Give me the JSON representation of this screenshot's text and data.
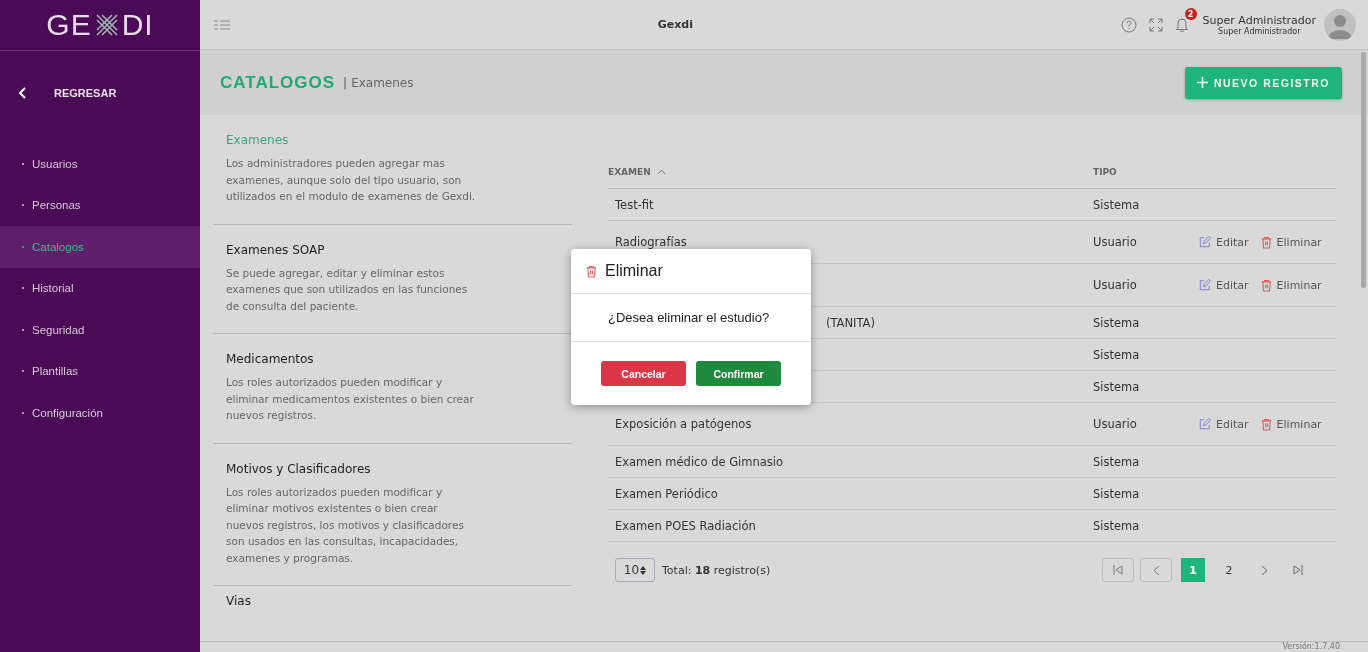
{
  "sidebar": {
    "logo_left": "GE",
    "logo_right": "DI",
    "back": "REGRESAR",
    "items": [
      {
        "label": "Usuarios",
        "selected": false
      },
      {
        "label": "Personas",
        "selected": false
      },
      {
        "label": "Catalogos",
        "selected": true
      },
      {
        "label": "Historial",
        "selected": false
      },
      {
        "label": "Seguridad",
        "selected": false
      },
      {
        "label": "Plantillas",
        "selected": false
      },
      {
        "label": "Configuración",
        "selected": false
      }
    ]
  },
  "topbar": {
    "title": "Gexdi",
    "notification_count": "2",
    "user_name": "Super Administrador",
    "user_role": "Super Administrador"
  },
  "header": {
    "title": "CATALOGOS",
    "separator": "|",
    "subtitle": "Examenes",
    "new_button": "NUEVO REGISTRO"
  },
  "catalogs": [
    {
      "title": "Examenes",
      "selected": true,
      "description": "Los administradores pueden agregar mas examenes, aunque solo del tipo usuario, son utilizados en el modulo de examenes de Gexdi."
    },
    {
      "title": "Examenes SOAP",
      "selected": false,
      "description": "Se puede agregar, editar y eliminar estos examenes que son utilizados en las funciones de consulta del paciente."
    },
    {
      "title": "Medicamentos",
      "selected": false,
      "description": "Los roles autorizados pueden modificar y eliminar medicamentos existentes o bien crear nuevos registros."
    },
    {
      "title": "Motivos y Clasificadores",
      "selected": false,
      "description": "Los roles autorizados pueden modificar y eliminar motivos existentes o bien crear nuevos registros, los motivos y clasificadores son usados en las consultas, incapacidades, examenes y programas."
    },
    {
      "title": "Vias",
      "selected": false
    }
  ],
  "table": {
    "columns": [
      {
        "label": "EXAMEN",
        "sorted": true
      },
      {
        "label": "TIPO"
      }
    ],
    "rows": [
      {
        "name": "Test-fit",
        "type": "Sistema",
        "covered": false,
        "actions": []
      },
      {
        "name": "Radiografías",
        "type": "Usuario",
        "covered": false,
        "actions": [
          {
            "kind": "edit",
            "label": "Editar"
          },
          {
            "kind": "delete",
            "label": "Eliminar"
          }
        ]
      },
      {
        "type": "Usuario",
        "actions": [
          {
            "kind": "edit",
            "label": "Editar"
          },
          {
            "kind": "delete",
            "label": "Eliminar"
          }
        ]
      },
      {
        "name": "(TANITA)",
        "type": "Sistema",
        "covered": true,
        "actions": []
      },
      {
        "type": "Sistema",
        "actions": []
      },
      {
        "type": "Sistema",
        "actions": []
      },
      {
        "name": "Exposición a patógenos",
        "type": "Usuario",
        "covered": false,
        "actions": [
          {
            "kind": "edit",
            "label": "Editar"
          },
          {
            "kind": "delete",
            "label": "Eliminar"
          }
        ]
      },
      {
        "name": "Examen médico de Gimnasio",
        "type": "Sistema",
        "covered": false,
        "actions": []
      },
      {
        "name": "Examen Periódico",
        "type": "Sistema",
        "covered": false,
        "actions": []
      },
      {
        "name": "Examen POES Radiación",
        "type": "Sistema",
        "covered": false,
        "actions": []
      }
    ]
  },
  "pagination": {
    "page_size": "10",
    "total": "Total:  **18** registro(s)",
    "pages": [
      {
        "label": "1",
        "selected": true
      },
      {
        "label": "2",
        "selected": false
      }
    ]
  },
  "modal": {
    "title": "Eliminar",
    "message": "¿Desea eliminar el estudio?",
    "buttons": [
      {
        "kind": "cancel",
        "label": "Cancelar"
      },
      {
        "kind": "confirm",
        "label": "Confirmar"
      }
    ]
  },
  "footer": {
    "version": "Versión:1.7.40"
  }
}
